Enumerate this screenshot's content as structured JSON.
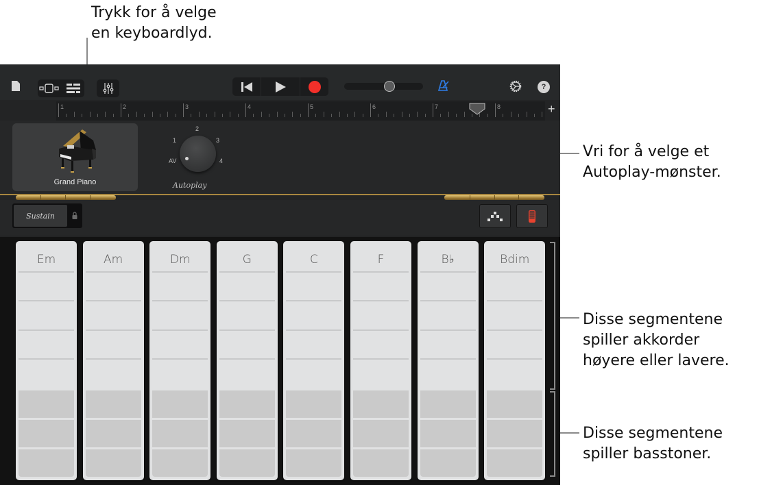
{
  "callouts": {
    "keyboard_sound": [
      "Trykk for å velge",
      "en keyboardlyd."
    ],
    "autoplay": [
      "Vri for å velge et",
      "Autoplay-mønster."
    ],
    "chords": [
      "Disse segmentene",
      "spiller akkorder",
      "høyere eller lavere."
    ],
    "bass": [
      "Disse segmentene",
      "spiller basstoner."
    ]
  },
  "toolbar": {
    "icons": [
      "document-icon",
      "view-toggle-icon",
      "tracks-view-icon",
      "mixer-icon",
      "rewind-icon",
      "play-icon",
      "record-icon",
      "master-volume-slider",
      "metronome-icon",
      "settings-icon",
      "help-icon"
    ],
    "help_label": "?",
    "record_color": "#f3302a",
    "metronome_color": "#2f7ee8",
    "volume_level": 0.58
  },
  "ruler": {
    "bars": [
      "1",
      "2",
      "3",
      "4",
      "5",
      "6",
      "7",
      "8"
    ],
    "add_label": "+",
    "playhead_bar": 7.6
  },
  "instrument": {
    "name": "Grand Piano"
  },
  "autoplay": {
    "label": "Autoplay",
    "positions": [
      "AV",
      "1",
      "2",
      "3",
      "4"
    ],
    "selected": "AV"
  },
  "controls": {
    "sustain_label": "Sustain",
    "arpeggiator_icon": "arpeggiator-icon",
    "chord_strips_icon": "chord-strips-icon",
    "accent_color": "#e8432f"
  },
  "chords": [
    {
      "label": "Em"
    },
    {
      "label": "Am"
    },
    {
      "label": "Dm"
    },
    {
      "label": "G"
    },
    {
      "label": "C"
    },
    {
      "label": "F"
    },
    {
      "label": "B♭"
    },
    {
      "label": "Bdim"
    }
  ]
}
